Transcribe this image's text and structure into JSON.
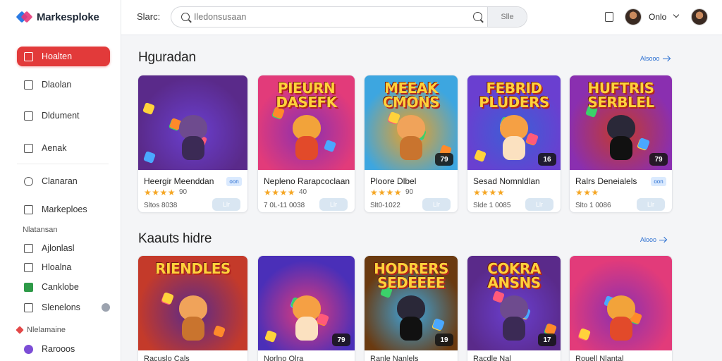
{
  "brand": {
    "name": "Markesploke"
  },
  "header": {
    "search_label": "Slarc:",
    "search_placeholder": "Iledonsusaan",
    "search_submit": "Slle",
    "user_name": "Onlo"
  },
  "sidebar": {
    "items": [
      {
        "label": "Hoalten",
        "active": true
      },
      {
        "label": "Dlaolan"
      },
      {
        "label": "Dldument"
      },
      {
        "label": "Aenak"
      },
      {
        "label": "Clanaran"
      },
      {
        "label": "Markeploes"
      }
    ],
    "section1": "Nlatansan",
    "sub_items": [
      {
        "label": "Ajlonlasl"
      },
      {
        "label": "Hloalna"
      },
      {
        "label": "Canklobe"
      },
      {
        "label": "Slenelons"
      }
    ],
    "section2": "Nlelamaine",
    "bottom_items": [
      {
        "label": "Rarooos"
      }
    ]
  },
  "sections": [
    {
      "title": "Hguradan",
      "see_all": "Alsooo"
    },
    {
      "title": "Kaauts hidre",
      "see_all": "Alooo"
    }
  ],
  "row1": [
    {
      "title": "Heergir Meenddan",
      "tag": "oon",
      "rating": "90",
      "meta": "Sltos 8038",
      "btn": "Llr",
      "art_title": "",
      "badge": ""
    },
    {
      "title": "Nepleno Rarapcoclaan",
      "tag": "",
      "rating": "40",
      "meta": "7 0L-11 0038",
      "btn": "Llr",
      "art_title": "PIEURN DASEFK",
      "badge": ""
    },
    {
      "title": "Ploore Dlbel",
      "tag": "",
      "rating": "90",
      "meta": "Slt0-1022",
      "btn": "Llr",
      "art_title": "MEEAK CMONS",
      "badge": "79"
    },
    {
      "title": "Sesad Nomnldlan",
      "tag": "",
      "rating": "",
      "meta": "Slde 1 0085",
      "btn": "Llr",
      "art_title": "FEBRID PLUDERS",
      "badge": "16"
    },
    {
      "title": "Ralrs Deneialels",
      "tag": "oon",
      "rating": "",
      "meta": "Slto 1 0086",
      "btn": "Llr",
      "art_title": "HUFTRIS SERBLEL",
      "badge": "79"
    }
  ],
  "row2": [
    {
      "title": "Racuslo Cals",
      "art_title": "RIENDLES",
      "badge": ""
    },
    {
      "title": "Norlno Olra",
      "art_title": "",
      "badge": "79"
    },
    {
      "title": "Ranle Nanlels",
      "art_title": "HODRERS SEDEEEE",
      "badge": "19"
    },
    {
      "title": "Racdle Nal",
      "art_title": "COKRA ANSNS",
      "badge": "17"
    },
    {
      "title": "Rouell Nlantal",
      "art_title": "",
      "badge": ""
    }
  ],
  "colors": {
    "accent": "#e23a3a",
    "link": "#2b6fd1",
    "star": "#f5a623",
    "art_backgrounds": [
      "#5a2a8a",
      "#e23b7a",
      "#3da6e0",
      "#6a3fd0",
      "#8a2fb0",
      "#f0a020",
      "#3b5fd6",
      "#c43a2a",
      "#4a2fb8",
      "#6a3a10"
    ]
  },
  "icons": [
    "search-icon",
    "bell-icon",
    "arrow-right-icon",
    "star-icon"
  ]
}
